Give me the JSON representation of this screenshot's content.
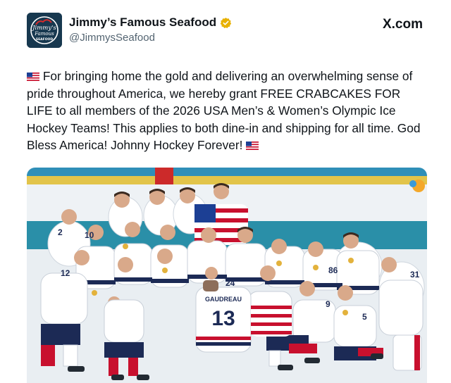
{
  "post": {
    "account": {
      "display_name": "Jimmy’s Famous Seafood",
      "handle": "@JimmysSeafood",
      "verified": true,
      "avatar_text": [
        "Jimmy's",
        "Famous",
        "SEAFOOD"
      ]
    },
    "site_label": "X.com",
    "body": {
      "text": "For bringing home the gold and delivering an overwhelming sense of pride throughout America, we hereby grant FREE CRABCAKES FOR LIFE to all members of the 2026 USA Men’s & Women’s Olympic Ice Hockey Teams! This applies to both dine-in and shipping for all time. God Bless America! Johnny Hockey Forever!",
      "leading_emoji": "us-flag-emoji",
      "trailing_emoji": "us-flag-emoji"
    },
    "photo": {
      "jersey_name": "GAUDREAU",
      "jersey_number": "13",
      "visible_numbers": [
        "2",
        "10",
        "12",
        "24",
        "86",
        "9",
        "5",
        "31"
      ]
    }
  },
  "colors": {
    "text": "#0f1419",
    "secondary": "#536471",
    "verified_badge": "#e8b100",
    "navy": "#1c2a55",
    "red": "#c8102e"
  }
}
